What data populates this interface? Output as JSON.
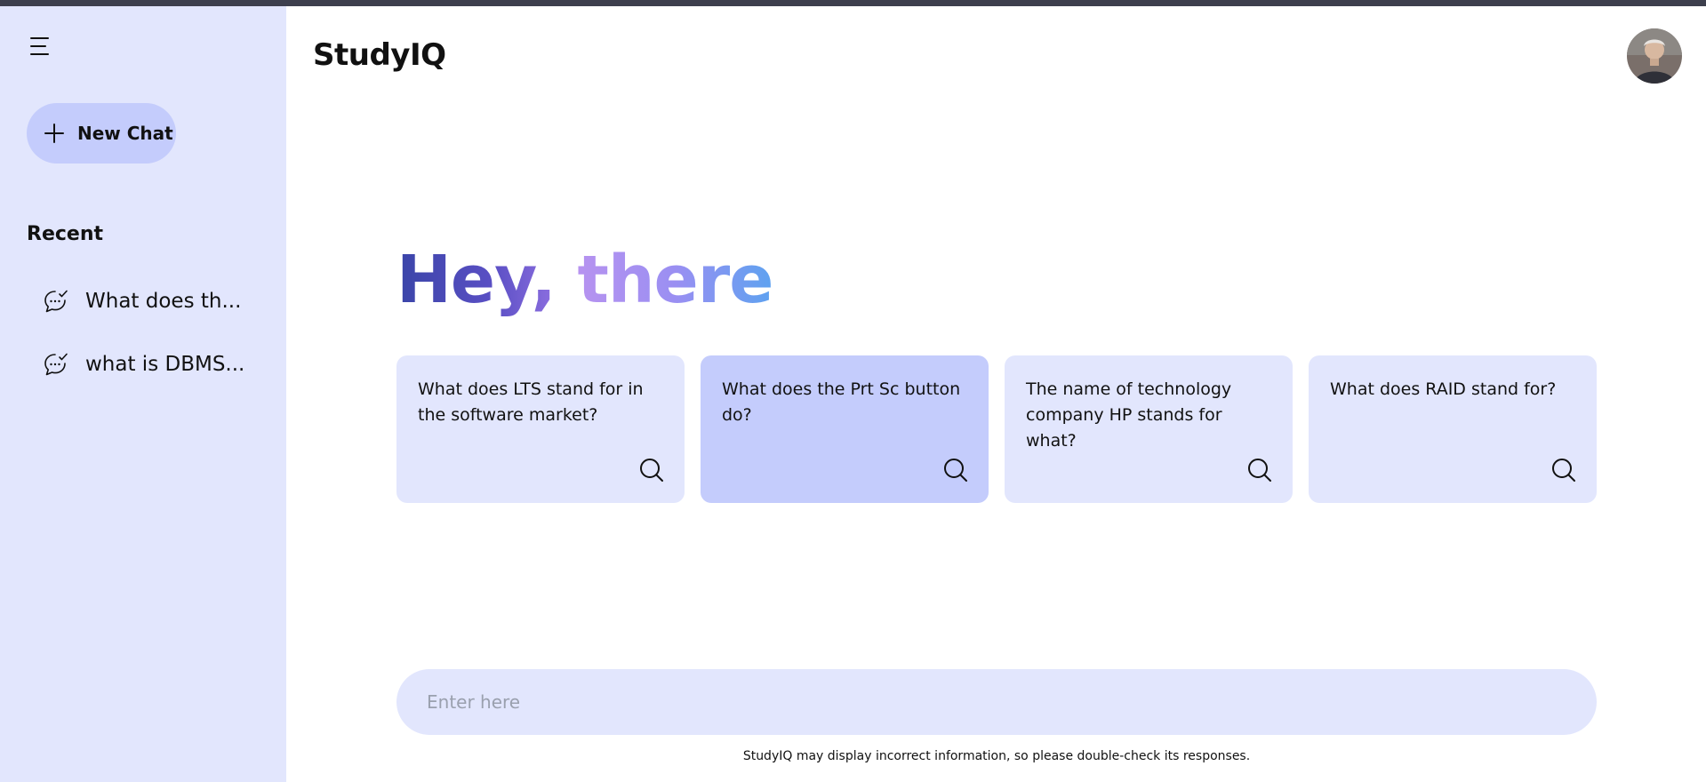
{
  "app": {
    "brand": "StudyIQ"
  },
  "sidebar": {
    "new_chat_label": "New Chat",
    "recent_title": "Recent",
    "recent_items": [
      {
        "label": "What does th..."
      },
      {
        "label": "what is DBMS..."
      }
    ]
  },
  "greeting": {
    "word1": "Hey,",
    "word2": "there"
  },
  "suggestions": [
    {
      "text": "What does LTS stand for in the software market?"
    },
    {
      "text": "What does the Prt Sc button do?"
    },
    {
      "text": "The name of technology company HP stands for what?"
    },
    {
      "text": "What does RAID stand for?"
    }
  ],
  "prompt": {
    "placeholder": "Enter here",
    "value": ""
  },
  "disclaimer": "StudyIQ may display incorrect information, so please double-check its responses.",
  "colors": {
    "sidebar_bg": "#e2e6fd",
    "accent": "#c4ccfc",
    "greeting_start": "#3a45a8",
    "greeting_end": "#5ea2f0"
  },
  "icons": {
    "menu": "menu-icon",
    "new_chat": "plus-icon",
    "recent": "chat-bubble-icon",
    "suggestion": "search-icon",
    "avatar": "user-avatar"
  }
}
